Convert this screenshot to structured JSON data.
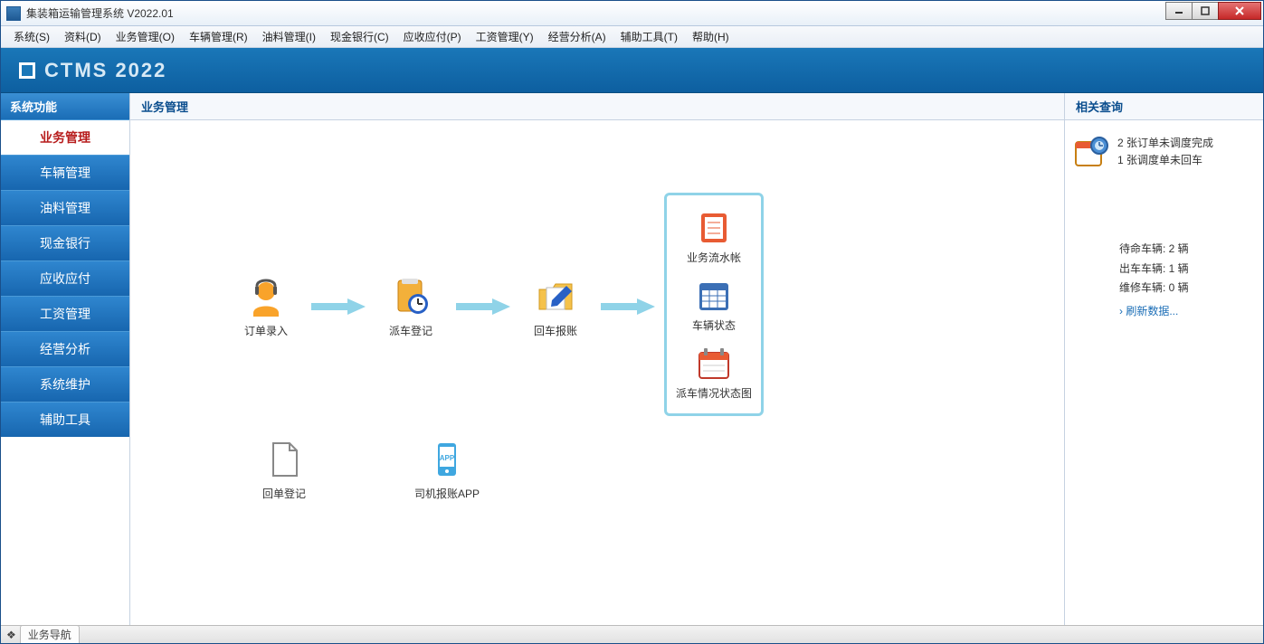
{
  "window": {
    "title": "集装箱运输管理系统 V2022.01"
  },
  "menu": {
    "items": [
      "系统(S)",
      "资料(D)",
      "业务管理(O)",
      "车辆管理(R)",
      "油料管理(I)",
      "现金银行(C)",
      "应收应付(P)",
      "工资管理(Y)",
      "经营分析(A)",
      "辅助工具(T)",
      "帮助(H)"
    ]
  },
  "brand": "CTMS 2022",
  "sidebar": {
    "header": "系统功能",
    "items": [
      "业务管理",
      "车辆管理",
      "油料管理",
      "现金银行",
      "应收应付",
      "工资管理",
      "经营分析",
      "系统维护",
      "辅助工具"
    ],
    "active_index": 0
  },
  "content": {
    "header": "业务管理",
    "flow": [
      "订单录入",
      "派车登记",
      "回车报账"
    ],
    "stack": [
      "业务流水帐",
      "车辆状态",
      "派车情况状态图"
    ],
    "row2": [
      "回单登记",
      "司机报账APP"
    ]
  },
  "rightpanel": {
    "header": "相关查询",
    "notif": {
      "line1": "2 张订单未调度完成",
      "line2": "1 张调度单未回车"
    },
    "stats": {
      "idle": "待命车辆: 2 辆",
      "out": "出车车辆: 1 辆",
      "repair": "维修车辆: 0 辆",
      "refresh": "› 刷新数据..."
    }
  },
  "statusbar": {
    "tab": "业务导航"
  }
}
